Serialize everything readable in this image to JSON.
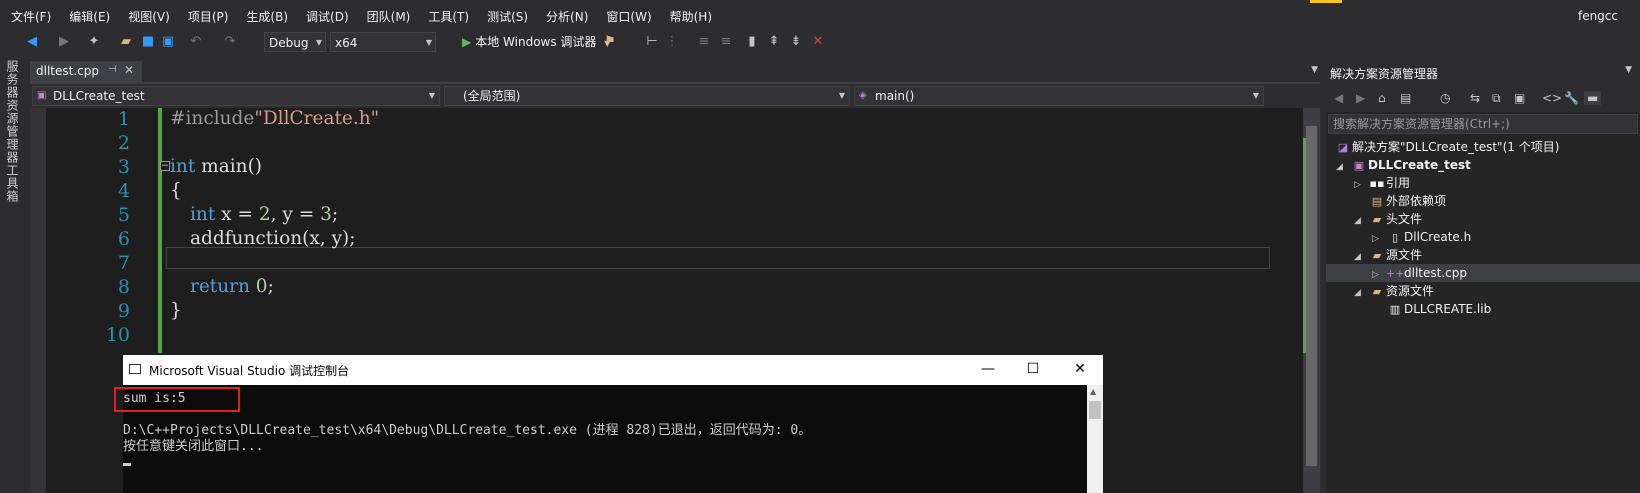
{
  "menu": {
    "items": [
      "文件(F)",
      "编辑(E)",
      "视图(V)",
      "项目(P)",
      "生成(B)",
      "调试(D)",
      "团队(M)",
      "工具(T)",
      "测试(S)",
      "分析(N)",
      "窗口(W)",
      "帮助(H)"
    ],
    "user": "fengcc"
  },
  "toolbar": {
    "config": "Debug",
    "platform": "x64",
    "run_label": "本地 Windows 调试器"
  },
  "left_strip": {
    "server_explorer": "服务器资源管理器",
    "toolbox": "工具箱"
  },
  "editor": {
    "tab_label": "dlltest.cpp",
    "nav_project": "DLLCreate_test",
    "nav_scope": "(全局范围)",
    "nav_member": "main()",
    "line_numbers": [
      "1",
      "2",
      "3",
      "4",
      "5",
      "6",
      "7",
      "8",
      "9",
      "10"
    ],
    "code": {
      "l1_pp": "#include",
      "l1_str": "\"DllCreate.h\"",
      "l3_kw": "int",
      "l3_rest": " main()",
      "l4": "{",
      "l5_kw": "int",
      "l5_a": " x = ",
      "l5_n1": "2",
      "l5_b": ", y = ",
      "l5_n2": "3",
      "l5_c": ";",
      "l6": "addfunction(x, y);",
      "l8_kw": "return",
      "l8_sp": " ",
      "l8_n": "0",
      "l8_c": ";",
      "l9": "}"
    }
  },
  "solution_explorer": {
    "title": "解决方案资源管理器",
    "search_placeholder": "搜索解决方案资源管理器(Ctrl+;)",
    "tree": {
      "solution": "解决方案\"DLLCreate_test\"(1 个项目)",
      "project": "DLLCreate_test",
      "references": "引用",
      "external_deps": "外部依赖项",
      "header_files": "头文件",
      "dllcreate_h": "DllCreate.h",
      "source_files": "源文件",
      "dlltest_cpp": "dlltest.cpp",
      "resource_files": "资源文件",
      "dllcreate_lib": "DLLCREATE.lib"
    }
  },
  "console": {
    "title": "Microsoft Visual Studio 调试控制台",
    "line1": "sum is:5",
    "line2": "D:\\C++Projects\\DLLCreate_test\\x64\\Debug\\DLLCreate_test.exe (进程 828)已退出，返回代码为: 0。",
    "line3": "按任意键关闭此窗口..."
  },
  "colors": {
    "keyword": "#569cd6",
    "string": "#d69d85",
    "line_number": "#2b91af",
    "highlight_box": "#e02020"
  }
}
